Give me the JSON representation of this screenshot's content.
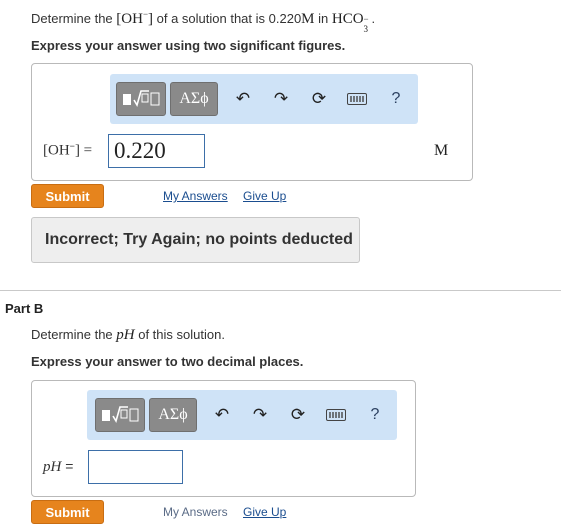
{
  "part_a": {
    "question": {
      "prefix": "Determine the ",
      "math_oh": "[OH",
      "math_oh_sup": "−",
      "math_oh_close": "]",
      "middle": " of a solution that is 0.220",
      "unit_m": "M",
      "in_text": " in ",
      "hco": "HCO",
      "hco_sub": "3",
      "hco_sup": "−",
      "period": "."
    },
    "instruction": "Express your answer using two significant figures.",
    "toolbar": {
      "template_icon": "fraction-root-template-icon",
      "greek_label": "ΑΣϕ",
      "undo_icon": "undo-icon",
      "redo_icon": "redo-icon",
      "reset_icon": "reset-icon",
      "keyboard_icon": "keyboard-icon",
      "help_label": "?"
    },
    "answer_label": "[OH",
    "answer_label_sup": "−",
    "answer_label_close": "] =",
    "answer_value": "0.220",
    "unit": "M",
    "submit_label": "Submit",
    "my_answers_label": "My Answers",
    "give_up_label": "Give Up",
    "feedback": "Incorrect; Try Again; no points deducted"
  },
  "part_b": {
    "title": "Part B",
    "question_prefix": "Determine the ",
    "question_math": "pH",
    "question_suffix": " of this solution.",
    "instruction": "Express your answer to two decimal places.",
    "toolbar": {
      "greek_label": "ΑΣϕ",
      "help_label": "?"
    },
    "answer_label_math": "pH",
    "answer_label_eq": " =",
    "answer_value": "",
    "submit_label": "Submit",
    "my_answers_label": "My Answers",
    "give_up_label": "Give Up"
  },
  "colors": {
    "submit": "#e6841d",
    "toolbar": "#cfe3f7",
    "link": "#1a4d8f"
  }
}
